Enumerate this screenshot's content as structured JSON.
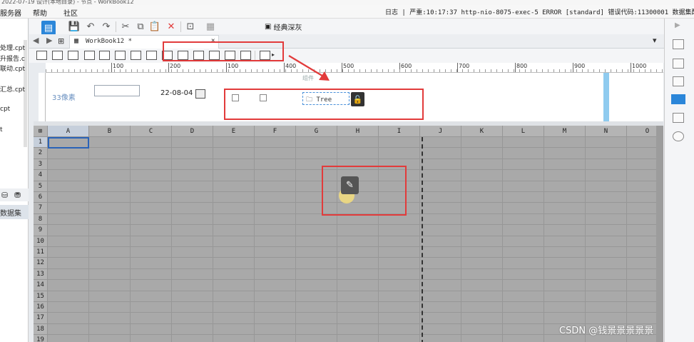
{
  "title_strip": "2022-07-19 设计(本地目录) - 节点 - WorkBook12",
  "menu": {
    "items": [
      "服务器",
      "帮助",
      "社区"
    ],
    "status": "日志 | 严重:10:17:37 http-nio-8075-exec-5 ERROR [standard] 错误代码:11300001 数据集配置错误"
  },
  "left_panel": {
    "files": [
      "处理.cpt",
      "升报告.c",
      "联动.cpt",
      "汇总.cpt",
      "cpt",
      "t"
    ],
    "dataset_label": "数据集"
  },
  "toolbar": {
    "theme_label": "经典深灰"
  },
  "tab": {
    "name": "WorkBook12 *"
  },
  "ruler": {
    "labels": [
      "100",
      "200",
      "100",
      "400",
      "500",
      "600",
      "700",
      "800",
      "900",
      "1000"
    ]
  },
  "form": {
    "label_text": "33像素",
    "date_value": "22-08-04",
    "tree_label": "Tree",
    "faint_label": "组件"
  },
  "grid": {
    "columns": [
      "A",
      "B",
      "C",
      "D",
      "E",
      "F",
      "G",
      "H",
      "I",
      "J",
      "K",
      "L",
      "M",
      "N",
      "O"
    ],
    "rows": [
      "1",
      "2",
      "3",
      "4",
      "5",
      "6",
      "7",
      "8",
      "9",
      "10",
      "11",
      "12",
      "13",
      "14",
      "15",
      "16",
      "17",
      "18",
      "19"
    ]
  },
  "watermark": "CSDN @钱景景景景景",
  "colors": {
    "accent": "#2b86d9",
    "annotation": "#e23b3b",
    "grid_bg": "#a9a9a9"
  }
}
